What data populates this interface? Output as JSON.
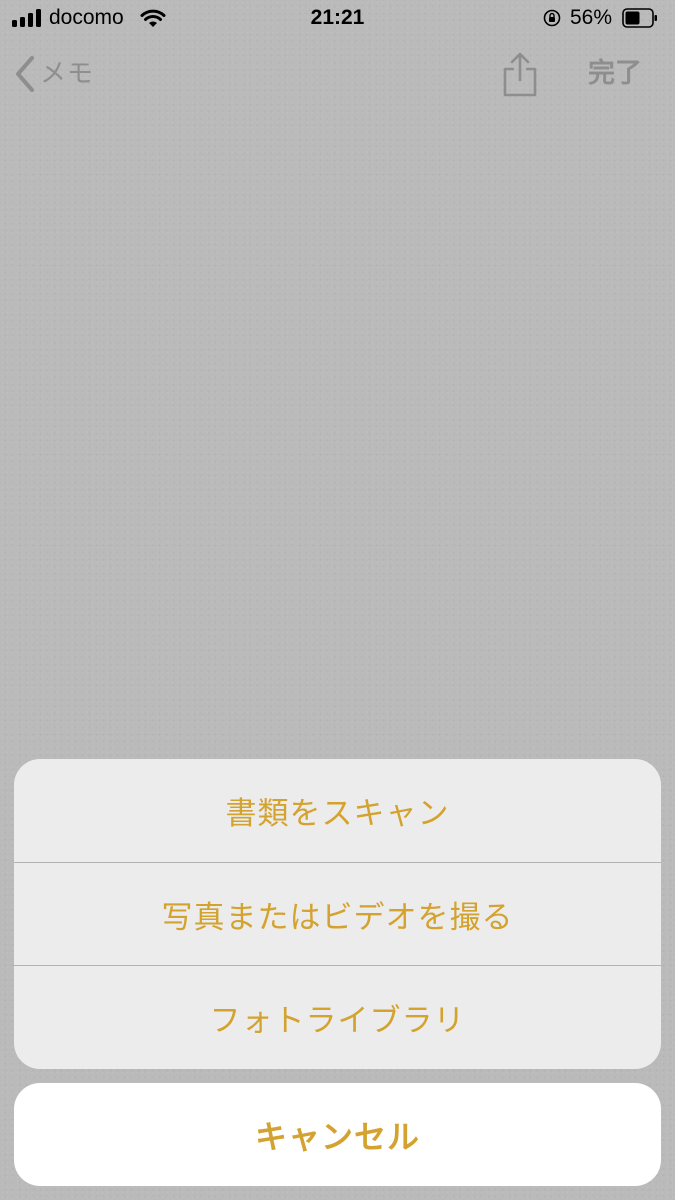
{
  "status_bar": {
    "carrier": "docomo",
    "time": "21:21",
    "battery_percent": "56%",
    "battery_level": 0.56,
    "signal_bars": 4
  },
  "nav": {
    "back_label": "メモ",
    "done_label": "完了",
    "share_icon": "share-icon"
  },
  "action_sheet": {
    "items": [
      {
        "label": "書類をスキャン"
      },
      {
        "label": "写真またはビデオを撮る"
      },
      {
        "label": "フォトライブラリ"
      }
    ],
    "cancel_label": "キャンセル"
  },
  "colors": {
    "accent": "#d4a22e",
    "background_dimmed": "#bababa",
    "sheet_background": "#ececec",
    "nav_text": "#8e8e8e"
  }
}
